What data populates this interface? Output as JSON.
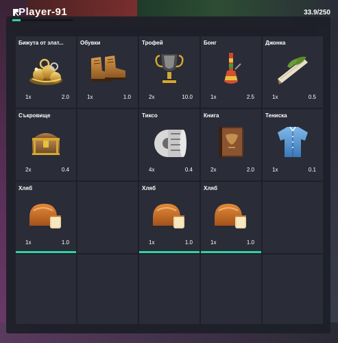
{
  "player": {
    "name": "Player-91",
    "weight": "33.9/250",
    "weight_fraction": 0.136
  },
  "accent": "#2ed3a4",
  "slots": [
    {
      "name": "Бижута от злат...",
      "qty": "1x",
      "weight": "2.0",
      "icon": "jewelry-icon",
      "underline": false
    },
    {
      "name": "Обувки",
      "qty": "1x",
      "weight": "1.0",
      "icon": "boots-icon",
      "underline": false
    },
    {
      "name": "Трофей",
      "qty": "2x",
      "weight": "10.0",
      "icon": "trophy-icon",
      "underline": false
    },
    {
      "name": "Бонг",
      "qty": "1x",
      "weight": "2.5",
      "icon": "bong-icon",
      "underline": false
    },
    {
      "name": "Джонка",
      "qty": "1x",
      "weight": "0.5",
      "icon": "joint-icon",
      "underline": false
    },
    {
      "name": "Съкровище",
      "qty": "2x",
      "weight": "0.4",
      "icon": "treasure-chest-icon",
      "underline": false
    },
    {},
    {
      "name": "Тиксо",
      "qty": "4x",
      "weight": "0.4",
      "icon": "tape-icon",
      "underline": false
    },
    {
      "name": "Книга",
      "qty": "2x",
      "weight": "2.0",
      "icon": "book-icon",
      "underline": false
    },
    {
      "name": "Тениска",
      "qty": "1x",
      "weight": "0.1",
      "icon": "shirt-icon",
      "underline": false
    },
    {
      "name": "Хляб",
      "qty": "1x",
      "weight": "1.0",
      "icon": "bread-icon",
      "underline": true
    },
    {},
    {
      "name": "Хляб",
      "qty": "1x",
      "weight": "1.0",
      "icon": "bread-icon",
      "underline": true
    },
    {
      "name": "Хляб",
      "qty": "1x",
      "weight": "1.0",
      "icon": "bread-icon",
      "underline": true
    },
    {},
    {},
    {},
    {},
    {},
    {}
  ]
}
